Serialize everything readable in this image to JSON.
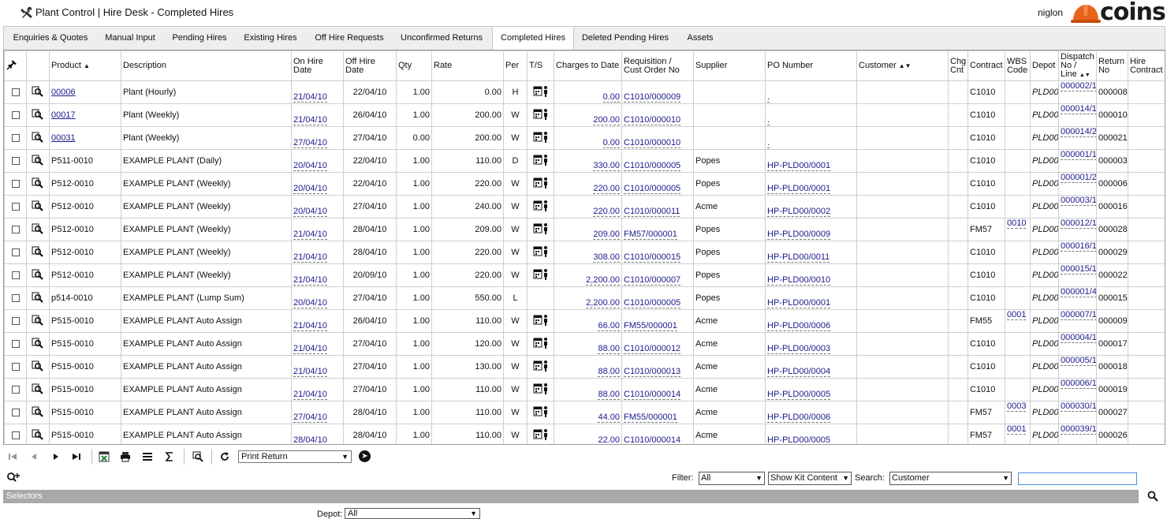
{
  "window": {
    "title": "Plant Control | Hire Desk - Completed Hires",
    "user": "niglon",
    "logo_text": "coins"
  },
  "tabs": [
    {
      "label": "Enquiries & Quotes"
    },
    {
      "label": "Manual Input"
    },
    {
      "label": "Pending Hires"
    },
    {
      "label": "Existing Hires"
    },
    {
      "label": "Off Hire Requests"
    },
    {
      "label": "Unconfirmed Returns"
    },
    {
      "label": "Completed Hires",
      "active": true
    },
    {
      "label": "Deleted Pending Hires"
    },
    {
      "label": "Assets"
    }
  ],
  "columns": {
    "product": "Product",
    "description": "Description",
    "on_hire": "On Hire Date",
    "off_hire": "Off Hire Date",
    "qty": "Qty",
    "rate": "Rate",
    "per": "Per",
    "ts": "T/S",
    "charges": "Charges to Date",
    "requisition": "Requisition / Cust Order No",
    "supplier": "Supplier",
    "po": "PO Number",
    "customer": "Customer",
    "chg_cnt": "Chg Cnt",
    "contract": "Contract",
    "wbs": "WBS Code",
    "depot": "Depot",
    "dispatch": "Dispatch No / Line",
    "return": "Return No",
    "hire_contract": "Hire Contract"
  },
  "rows": [
    {
      "product": "00006",
      "product_link": true,
      "description": "Plant (Hourly)",
      "on": "21/04/10",
      "off": "22/04/10",
      "qty": "1.00",
      "rate": "0.00",
      "per": "H",
      "ts": true,
      "charges": "0.00",
      "req": "C1010/000009",
      "supplier": "",
      "po": ".",
      "customer": "",
      "chg": "",
      "contract": "C1010",
      "wbs": "",
      "depot": "PLD00",
      "dispatch": "000002/1",
      "ret": "000008",
      "hire": ""
    },
    {
      "product": "00017",
      "product_link": true,
      "description": "Plant (Weekly)",
      "on": "21/04/10",
      "off": "26/04/10",
      "qty": "1.00",
      "rate": "200.00",
      "per": "W",
      "ts": true,
      "charges": "200.00",
      "req": "C1010/000010",
      "supplier": "",
      "po": ".",
      "customer": "",
      "chg": "",
      "contract": "C1010",
      "wbs": "",
      "depot": "PLD00",
      "dispatch": "000014/1",
      "ret": "000010",
      "hire": ""
    },
    {
      "product": "00031",
      "product_link": true,
      "description": "Plant (Weekly)",
      "on": "27/04/10",
      "off": "27/04/10",
      "qty": "0.00",
      "rate": "200.00",
      "per": "W",
      "ts": true,
      "charges": "0.00",
      "req": "C1010/000010",
      "supplier": "",
      "po": ".",
      "customer": "",
      "chg": "",
      "contract": "C1010",
      "wbs": "",
      "depot": "PLD00",
      "dispatch": "000014/2",
      "ret": "000021",
      "hire": ""
    },
    {
      "product": "P511-0010",
      "product_link": false,
      "description": "EXAMPLE PLANT (Daily)",
      "on": "20/04/10",
      "off": "22/04/10",
      "qty": "1.00",
      "rate": "110.00",
      "per": "D",
      "ts": true,
      "charges": "330.00",
      "req": "C1010/000005",
      "supplier": "Popes",
      "po": "HP-PLD00/0001",
      "customer": "",
      "chg": "",
      "contract": "C1010",
      "wbs": "",
      "depot": "PLD00",
      "dispatch": "000001/1",
      "ret": "000003",
      "hire": ""
    },
    {
      "product": "P512-0010",
      "product_link": false,
      "description": "EXAMPLE PLANT (Weekly)",
      "on": "20/04/10",
      "off": "22/04/10",
      "qty": "1.00",
      "rate": "220.00",
      "per": "W",
      "ts": true,
      "charges": "220.00",
      "req": "C1010/000005",
      "supplier": "Popes",
      "po": "HP-PLD00/0001",
      "customer": "",
      "chg": "",
      "contract": "C1010",
      "wbs": "",
      "depot": "PLD00",
      "dispatch": "000001/2",
      "ret": "000006",
      "hire": ""
    },
    {
      "product": "P512-0010",
      "product_link": false,
      "description": "EXAMPLE PLANT (Weekly)",
      "on": "20/04/10",
      "off": "27/04/10",
      "qty": "1.00",
      "rate": "240.00",
      "per": "W",
      "ts": true,
      "charges": "220.00",
      "req": "C1010/000011",
      "supplier": "Acme",
      "po": "HP-PLD00/0002",
      "customer": "",
      "chg": "",
      "contract": "C1010",
      "wbs": "",
      "depot": "PLD00",
      "dispatch": "000003/1",
      "ret": "000016",
      "hire": ""
    },
    {
      "product": "P512-0010",
      "product_link": false,
      "description": "EXAMPLE PLANT (Weekly)",
      "on": "21/04/10",
      "off": "28/04/10",
      "qty": "1.00",
      "rate": "209.00",
      "per": "W",
      "ts": true,
      "charges": "209.00",
      "req": "FM57/000001",
      "supplier": "Popes",
      "po": "HP-PLD00/0009",
      "customer": "",
      "chg": "",
      "contract": "FM57",
      "wbs": "0010",
      "depot": "PLD00",
      "dispatch": "000012/1",
      "ret": "000028",
      "hire": ""
    },
    {
      "product": "P512-0010",
      "product_link": false,
      "description": "EXAMPLE PLANT (Weekly)",
      "on": "21/04/10",
      "off": "28/04/10",
      "qty": "1.00",
      "rate": "220.00",
      "per": "W",
      "ts": true,
      "charges": "308.00",
      "req": "C1010/000015",
      "supplier": "Popes",
      "po": "HP-PLD00/0011",
      "customer": "",
      "chg": "",
      "contract": "C1010",
      "wbs": "",
      "depot": "PLD00",
      "dispatch": "000016/1",
      "ret": "000029",
      "hire": ""
    },
    {
      "product": "P512-0010",
      "product_link": false,
      "description": "EXAMPLE PLANT (Weekly)",
      "on": "21/04/10",
      "off": "20/09/10",
      "qty": "1.00",
      "rate": "220.00",
      "per": "W",
      "ts": true,
      "charges": "2,200.00",
      "req": "C1010/000007",
      "supplier": "Popes",
      "po": "HP-PLD00/0010",
      "customer": "",
      "chg": "",
      "contract": "C1010",
      "wbs": "",
      "depot": "PLD00",
      "dispatch": "000015/1",
      "ret": "000022",
      "hire": ""
    },
    {
      "product": "p514-0010",
      "product_link": false,
      "description": "EXAMPLE PLANT (Lump Sum)",
      "on": "20/04/10",
      "off": "27/04/10",
      "qty": "1.00",
      "rate": "550.00",
      "per": "L",
      "ts": false,
      "charges": "2,200.00",
      "req": "C1010/000005",
      "supplier": "Popes",
      "po": "HP-PLD00/0001",
      "customer": "",
      "chg": "",
      "contract": "C1010",
      "wbs": "",
      "depot": "PLD00",
      "dispatch": "000001/4",
      "ret": "000015",
      "hire": ""
    },
    {
      "product": "P515-0010",
      "product_link": false,
      "description": "EXAMPLE PLANT Auto Assign",
      "on": "21/04/10",
      "off": "26/04/10",
      "qty": "1.00",
      "rate": "110.00",
      "per": "W",
      "ts": true,
      "charges": "66.00",
      "req": "FM55/000001",
      "supplier": "Acme",
      "po": "HP-PLD00/0006",
      "customer": "",
      "chg": "",
      "contract": "FM55",
      "wbs": "0001",
      "depot": "PLD00",
      "dispatch": "000007/1",
      "ret": "000009",
      "hire": ""
    },
    {
      "product": "P515-0010",
      "product_link": false,
      "description": "EXAMPLE PLANT Auto Assign",
      "on": "21/04/10",
      "off": "27/04/10",
      "qty": "1.00",
      "rate": "120.00",
      "per": "W",
      "ts": true,
      "charges": "88.00",
      "req": "C1010/000012",
      "supplier": "Acme",
      "po": "HP-PLD00/0003",
      "customer": "",
      "chg": "",
      "contract": "C1010",
      "wbs": "",
      "depot": "PLD00",
      "dispatch": "000004/1",
      "ret": "000017",
      "hire": ""
    },
    {
      "product": "P515-0010",
      "product_link": false,
      "description": "EXAMPLE PLANT Auto Assign",
      "on": "21/04/10",
      "off": "27/04/10",
      "qty": "1.00",
      "rate": "130.00",
      "per": "W",
      "ts": true,
      "charges": "88.00",
      "req": "C1010/000013",
      "supplier": "Acme",
      "po": "HP-PLD00/0004",
      "customer": "",
      "chg": "",
      "contract": "C1010",
      "wbs": "",
      "depot": "PLD00",
      "dispatch": "000005/1",
      "ret": "000018",
      "hire": ""
    },
    {
      "product": "P515-0010",
      "product_link": false,
      "description": "EXAMPLE PLANT Auto Assign",
      "on": "21/04/10",
      "off": "27/04/10",
      "qty": "1.00",
      "rate": "110.00",
      "per": "W",
      "ts": true,
      "charges": "88.00",
      "req": "C1010/000014",
      "supplier": "Acme",
      "po": "HP-PLD00/0005",
      "customer": "",
      "chg": "",
      "contract": "C1010",
      "wbs": "",
      "depot": "PLD00",
      "dispatch": "000006/1",
      "ret": "000019",
      "hire": ""
    },
    {
      "product": "P515-0010",
      "product_link": false,
      "description": "EXAMPLE PLANT Auto Assign",
      "on": "27/04/10",
      "off": "28/04/10",
      "qty": "1.00",
      "rate": "110.00",
      "per": "W",
      "ts": true,
      "charges": "44.00",
      "req": "FM55/000001",
      "supplier": "Acme",
      "po": "HP-PLD00/0006",
      "customer": "",
      "chg": "",
      "contract": "FM57",
      "wbs": "0003",
      "depot": "PLD00",
      "dispatch": "000030/1",
      "ret": "000027",
      "hire": ""
    },
    {
      "product": "P515-0010",
      "product_link": false,
      "description": "EXAMPLE PLANT Auto Assign",
      "on": "28/04/10",
      "off": "28/04/10",
      "qty": "1.00",
      "rate": "110.00",
      "per": "W",
      "ts": true,
      "charges": "22.00",
      "req": "C1010/000014",
      "supplier": "Acme",
      "po": "HP-PLD00/0005",
      "customer": "",
      "chg": "",
      "contract": "FM57",
      "wbs": "0001",
      "depot": "PLD00",
      "dispatch": "000039/1",
      "ret": "000026",
      "hire": ""
    }
  ],
  "toolbar": {
    "print_option": "Print Return"
  },
  "filter": {
    "filter_label": "Filter:",
    "filter_value": "All",
    "kit_value": "Show Kit Content",
    "search_label": "Search:",
    "search_field": "Customer",
    "search_text": ""
  },
  "selectors": {
    "title": "Selectors",
    "depot_label": "Depot:",
    "depot_value": "All"
  }
}
